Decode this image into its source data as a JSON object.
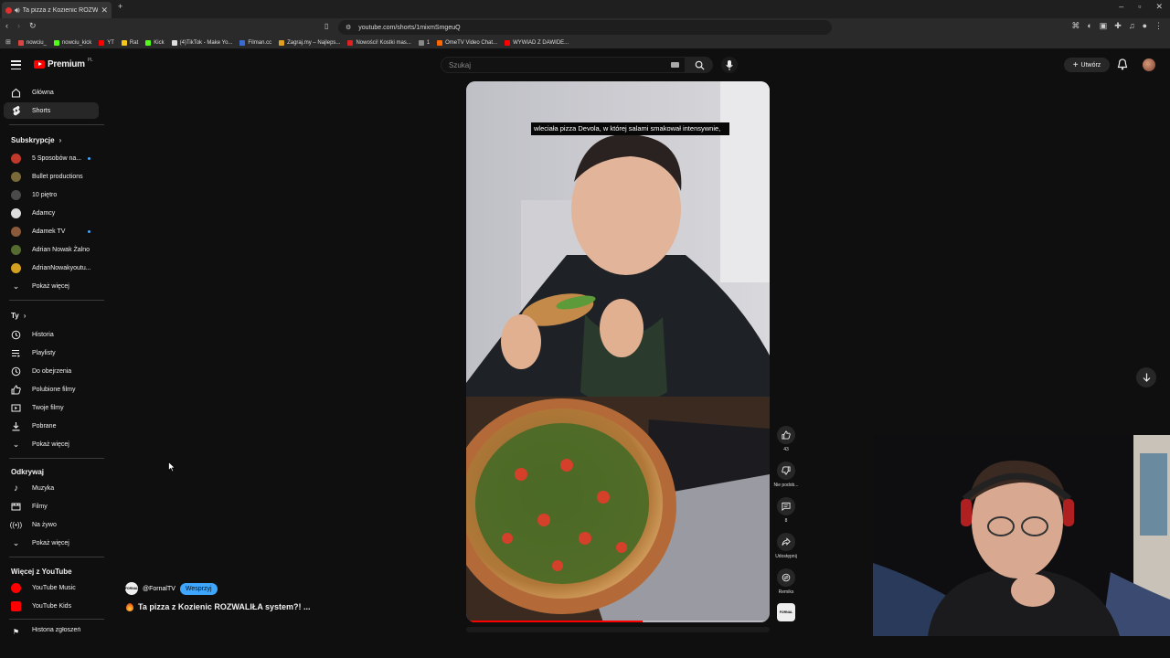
{
  "browser": {
    "tab_title": "Ta pizza z Kozienic ROZWALIŁA system?! ...",
    "url": "youtube.com/shorts/1mixmSmgeuQ",
    "bookmarks": [
      {
        "label": "nowciu_"
      },
      {
        "label": "nowciu_kick"
      },
      {
        "label": "YT"
      },
      {
        "label": "Rat"
      },
      {
        "label": "Kick"
      },
      {
        "label": "(4)TikTok - Make Yo..."
      },
      {
        "label": "Filman.cc"
      },
      {
        "label": "Zagraj.my – Najleps..."
      },
      {
        "label": "Nowości! Kostki mas..."
      },
      {
        "label": "1"
      },
      {
        "label": "OmeTV Video Chat..."
      },
      {
        "label": "WYWIAD Z DAWIDE..."
      }
    ]
  },
  "header": {
    "logo_text": "Premium",
    "logo_sup": "PL",
    "search_placeholder": "Szukaj",
    "create_label": "Utwórz"
  },
  "sidebar": {
    "main": [
      {
        "label": "Główna",
        "icon": "home-icon"
      },
      {
        "label": "Shorts",
        "icon": "shorts-icon",
        "active": true
      }
    ],
    "subs_heading": "Subskrypcje",
    "subs": [
      {
        "label": "5 Sposobów na...",
        "color": "#c0392b",
        "new": true
      },
      {
        "label": "Bullet productions",
        "color": "#7a6a3a",
        "new": false
      },
      {
        "label": "10 piętro",
        "color": "#4a4a4a",
        "new": false
      },
      {
        "label": "Adamcy",
        "color": "#dddddd",
        "new": false
      },
      {
        "label": "Adamek TV",
        "color": "#8a5a3a",
        "new": true
      },
      {
        "label": "Adrian Nowak Żalno",
        "color": "#556b2f",
        "new": false
      },
      {
        "label": "AdrianNowakyoutu...",
        "color": "#d4a020",
        "new": false
      }
    ],
    "show_more": "Pokaż więcej",
    "you_heading": "Ty",
    "you": [
      {
        "label": "Historia",
        "icon": "history-icon"
      },
      {
        "label": "Playlisty",
        "icon": "playlists-icon"
      },
      {
        "label": "Do obejrzenia",
        "icon": "watch-later-icon"
      },
      {
        "label": "Polubione filmy",
        "icon": "liked-icon"
      },
      {
        "label": "Twoje filmy",
        "icon": "your-videos-icon"
      },
      {
        "label": "Pobrane",
        "icon": "download-icon"
      }
    ],
    "explore_heading": "Odkrywaj",
    "explore": [
      {
        "label": "Muzyka",
        "icon": "music-icon"
      },
      {
        "label": "Filmy",
        "icon": "film-icon"
      },
      {
        "label": "Na żywo",
        "icon": "live-icon"
      }
    ],
    "more_heading": "Więcej z YouTube",
    "more": [
      {
        "label": "YouTube Music",
        "color": "#ff0000"
      },
      {
        "label": "YouTube Kids",
        "color": "#ff0000"
      }
    ],
    "cut_item": "Historia zgłoszeń"
  },
  "short": {
    "caption": "wleciała pizza Devola, w której salami smakował intensywnie,",
    "progress": 0.58,
    "channel": "@FornalTV",
    "channel_avatar_text": "FORNAL",
    "support_label": "Wesprzyj",
    "title": "Ta pizza z Kozienic ROZWALIŁA system?! ...",
    "actions": {
      "likes": "43",
      "dislike_label": "Nie podob...",
      "comments": "8",
      "share_label": "Udostępnij",
      "remix_label": "Remiks"
    }
  }
}
